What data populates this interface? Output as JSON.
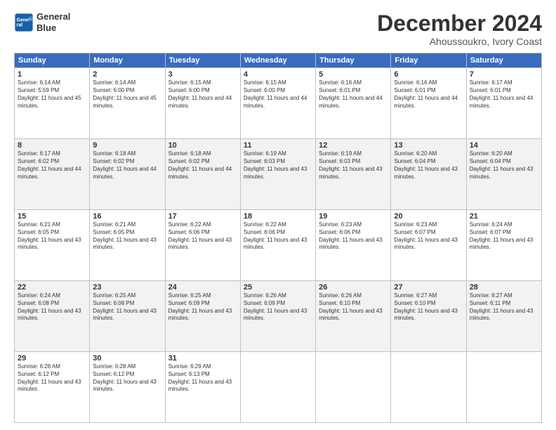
{
  "header": {
    "logo_line1": "General",
    "logo_line2": "Blue",
    "month": "December 2024",
    "location": "Ahoussoukro, Ivory Coast"
  },
  "weekdays": [
    "Sunday",
    "Monday",
    "Tuesday",
    "Wednesday",
    "Thursday",
    "Friday",
    "Saturday"
  ],
  "weeks": [
    [
      {
        "day": 1,
        "sunrise": "6:14 AM",
        "sunset": "5:59 PM",
        "daylight": "11 hours and 45 minutes."
      },
      {
        "day": 2,
        "sunrise": "6:14 AM",
        "sunset": "6:00 PM",
        "daylight": "11 hours and 45 minutes."
      },
      {
        "day": 3,
        "sunrise": "6:15 AM",
        "sunset": "6:00 PM",
        "daylight": "11 hours and 44 minutes."
      },
      {
        "day": 4,
        "sunrise": "6:15 AM",
        "sunset": "6:00 PM",
        "daylight": "11 hours and 44 minutes."
      },
      {
        "day": 5,
        "sunrise": "6:16 AM",
        "sunset": "6:01 PM",
        "daylight": "11 hours and 44 minutes."
      },
      {
        "day": 6,
        "sunrise": "6:16 AM",
        "sunset": "6:01 PM",
        "daylight": "11 hours and 44 minutes."
      },
      {
        "day": 7,
        "sunrise": "6:17 AM",
        "sunset": "6:01 PM",
        "daylight": "11 hours and 44 minutes."
      }
    ],
    [
      {
        "day": 8,
        "sunrise": "6:17 AM",
        "sunset": "6:02 PM",
        "daylight": "11 hours and 44 minutes."
      },
      {
        "day": 9,
        "sunrise": "6:18 AM",
        "sunset": "6:02 PM",
        "daylight": "11 hours and 44 minutes."
      },
      {
        "day": 10,
        "sunrise": "6:18 AM",
        "sunset": "6:02 PM",
        "daylight": "11 hours and 44 minutes."
      },
      {
        "day": 11,
        "sunrise": "6:19 AM",
        "sunset": "6:03 PM",
        "daylight": "11 hours and 43 minutes."
      },
      {
        "day": 12,
        "sunrise": "6:19 AM",
        "sunset": "6:03 PM",
        "daylight": "11 hours and 43 minutes."
      },
      {
        "day": 13,
        "sunrise": "6:20 AM",
        "sunset": "6:04 PM",
        "daylight": "11 hours and 43 minutes."
      },
      {
        "day": 14,
        "sunrise": "6:20 AM",
        "sunset": "6:04 PM",
        "daylight": "11 hours and 43 minutes."
      }
    ],
    [
      {
        "day": 15,
        "sunrise": "6:21 AM",
        "sunset": "6:05 PM",
        "daylight": "11 hours and 43 minutes."
      },
      {
        "day": 16,
        "sunrise": "6:21 AM",
        "sunset": "6:05 PM",
        "daylight": "11 hours and 43 minutes."
      },
      {
        "day": 17,
        "sunrise": "6:22 AM",
        "sunset": "6:06 PM",
        "daylight": "11 hours and 43 minutes."
      },
      {
        "day": 18,
        "sunrise": "6:22 AM",
        "sunset": "6:06 PM",
        "daylight": "11 hours and 43 minutes."
      },
      {
        "day": 19,
        "sunrise": "6:23 AM",
        "sunset": "6:06 PM",
        "daylight": "11 hours and 43 minutes."
      },
      {
        "day": 20,
        "sunrise": "6:23 AM",
        "sunset": "6:07 PM",
        "daylight": "11 hours and 43 minutes."
      },
      {
        "day": 21,
        "sunrise": "6:24 AM",
        "sunset": "6:07 PM",
        "daylight": "11 hours and 43 minutes."
      }
    ],
    [
      {
        "day": 22,
        "sunrise": "6:24 AM",
        "sunset": "6:08 PM",
        "daylight": "11 hours and 43 minutes."
      },
      {
        "day": 23,
        "sunrise": "6:25 AM",
        "sunset": "6:08 PM",
        "daylight": "11 hours and 43 minutes."
      },
      {
        "day": 24,
        "sunrise": "6:25 AM",
        "sunset": "6:09 PM",
        "daylight": "11 hours and 43 minutes."
      },
      {
        "day": 25,
        "sunrise": "6:26 AM",
        "sunset": "6:09 PM",
        "daylight": "11 hours and 43 minutes."
      },
      {
        "day": 26,
        "sunrise": "6:26 AM",
        "sunset": "6:10 PM",
        "daylight": "11 hours and 43 minutes."
      },
      {
        "day": 27,
        "sunrise": "6:27 AM",
        "sunset": "6:10 PM",
        "daylight": "11 hours and 43 minutes."
      },
      {
        "day": 28,
        "sunrise": "6:27 AM",
        "sunset": "6:11 PM",
        "daylight": "11 hours and 43 minutes."
      }
    ],
    [
      {
        "day": 29,
        "sunrise": "6:28 AM",
        "sunset": "6:12 PM",
        "daylight": "11 hours and 43 minutes."
      },
      {
        "day": 30,
        "sunrise": "6:28 AM",
        "sunset": "6:12 PM",
        "daylight": "11 hours and 43 minutes."
      },
      {
        "day": 31,
        "sunrise": "6:29 AM",
        "sunset": "6:13 PM",
        "daylight": "11 hours and 43 minutes."
      },
      null,
      null,
      null,
      null
    ]
  ]
}
